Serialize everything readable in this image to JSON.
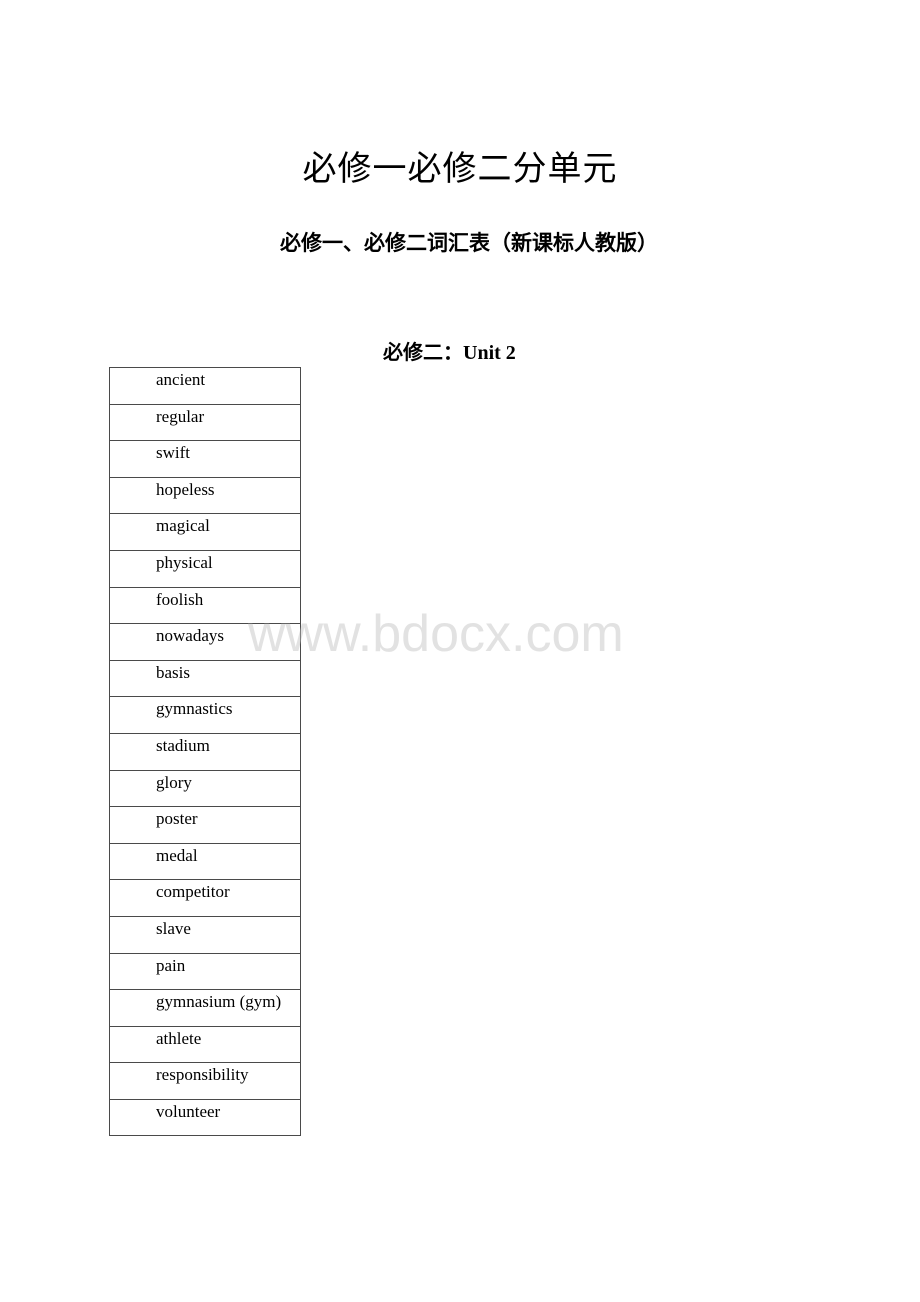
{
  "document": {
    "title": "必修一必修二分单元",
    "subtitle": "必修一、必修二词汇表（新课标人教版）",
    "section_heading": "必修二：Unit 2",
    "vocabulary": [
      "ancient",
      "regular",
      "swift",
      "hopeless",
      "magical",
      "physical",
      "foolish",
      "nowadays",
      "basis",
      "gymnastics",
      "stadium",
      "glory",
      "poster",
      "medal",
      "competitor",
      "slave",
      "pain",
      "gymnasium (gym)",
      "athlete",
      "responsibility",
      "volunteer"
    ]
  },
  "watermark": {
    "text": "www.bdocx.com",
    "color": "#bebebe"
  }
}
